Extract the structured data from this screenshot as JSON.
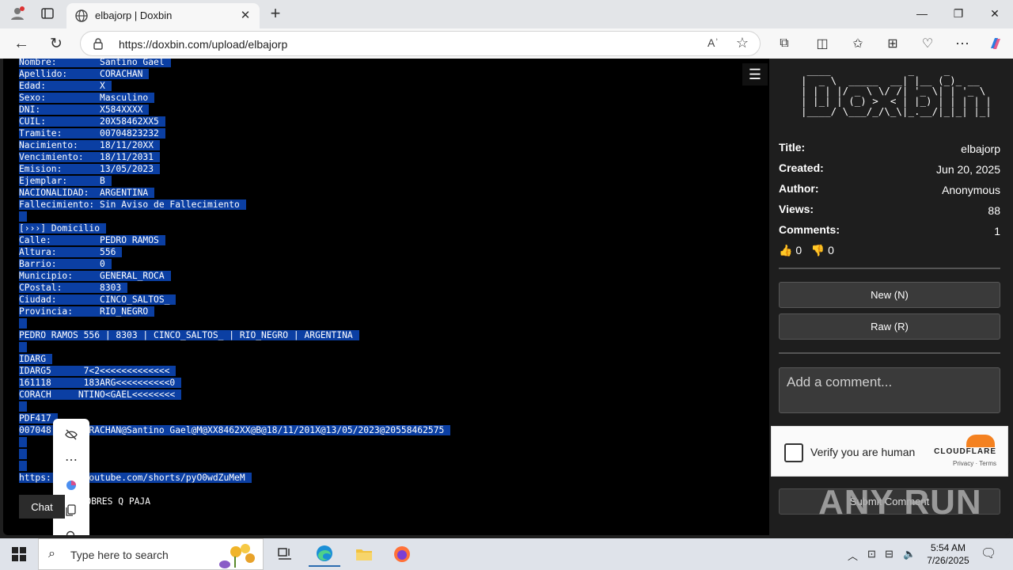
{
  "browser": {
    "tab_title": "elbajorp | Doxbin",
    "url": "https://doxbin.com/upload/elbajorp",
    "read_aloud_label": "Aʾ"
  },
  "paste": {
    "lines": [
      "Nombre:        Santino Gael",
      "Apellido:      CORACHAN",
      "Edad:          X",
      "Sexo:          Masculino",
      "DNI:           X584XXXX",
      "CUIL:          20X58462XX5",
      "Tramite:       00704823232",
      "Nacimiento:    18/11/20XX",
      "Vencimiento:   18/11/2031",
      "Emision:       13/05/2023",
      "Ejemplar:      B",
      "NACIONALIDAD:  ARGENTINA",
      "Fallecimiento: Sin Aviso de Fallecimiento",
      "",
      "[›››] Domicilio",
      "Calle:         PEDRO RAMOS",
      "Altura:        556",
      "Barrio:        0",
      "Municipio:     GENERAL_ROCA",
      "CPostal:       8303",
      "Ciudad:        CINCO_SALTOS_",
      "Provincia:     RIO_NEGRO",
      "",
      "PEDRO RAMOS 556 | 8303 | CINCO_SALTOS_ | RIO_NEGRO | ARGENTINA",
      "",
      "IDARG",
      "IDARG5      7<2<<<<<<<<<<<<<",
      "161118      183ARG<<<<<<<<<<0",
      "CORACH     NTINO<GAEL<<<<<<<<",
      "",
      "PDF417",
      "007048     CORACHAN@Santino Gael@M@XX8462XX@B@18/11/201X@13/05/2023@20558462575",
      "",
      "",
      "",
      "https:      youtube.com/shorts/pyO0wdZuMeM"
    ],
    "tail_text": "Y POBRES Q PAJA",
    "chat_label": "Chat"
  },
  "sidebar": {
    "ascii_logo": " ____             _     _       \n|  _ \\  _____  __| |__ (_)_ __  \n| | | |/ _ \\ \\/ /| '_ \\| | '_ \\ \n| |_| | (_) >  < | |_) | | | | |\n|____/ \\___/_/\\_\\|_.__/|_|_| |_|",
    "meta": [
      {
        "key": "Title:",
        "value": "elbajorp"
      },
      {
        "key": "Created:",
        "value": "Jun 20, 2025"
      },
      {
        "key": "Author:",
        "value": "Anonymous"
      },
      {
        "key": "Views:",
        "value": "88"
      },
      {
        "key": "Comments:",
        "value": "1"
      }
    ],
    "likes": "0",
    "dislikes": "0",
    "new_button": "New (N)",
    "raw_button": "Raw (R)",
    "comment_placeholder": "Add a comment...",
    "captcha_label": "Verify you are human",
    "captcha_brand": "CLOUDFLARE",
    "captcha_links": "Privacy · Terms",
    "submit_button": "Submit Comment"
  },
  "watermark": "ANY RUN",
  "taskbar": {
    "search_placeholder": "Type here to search",
    "time": "5:54 AM",
    "date": "7/26/2025"
  }
}
